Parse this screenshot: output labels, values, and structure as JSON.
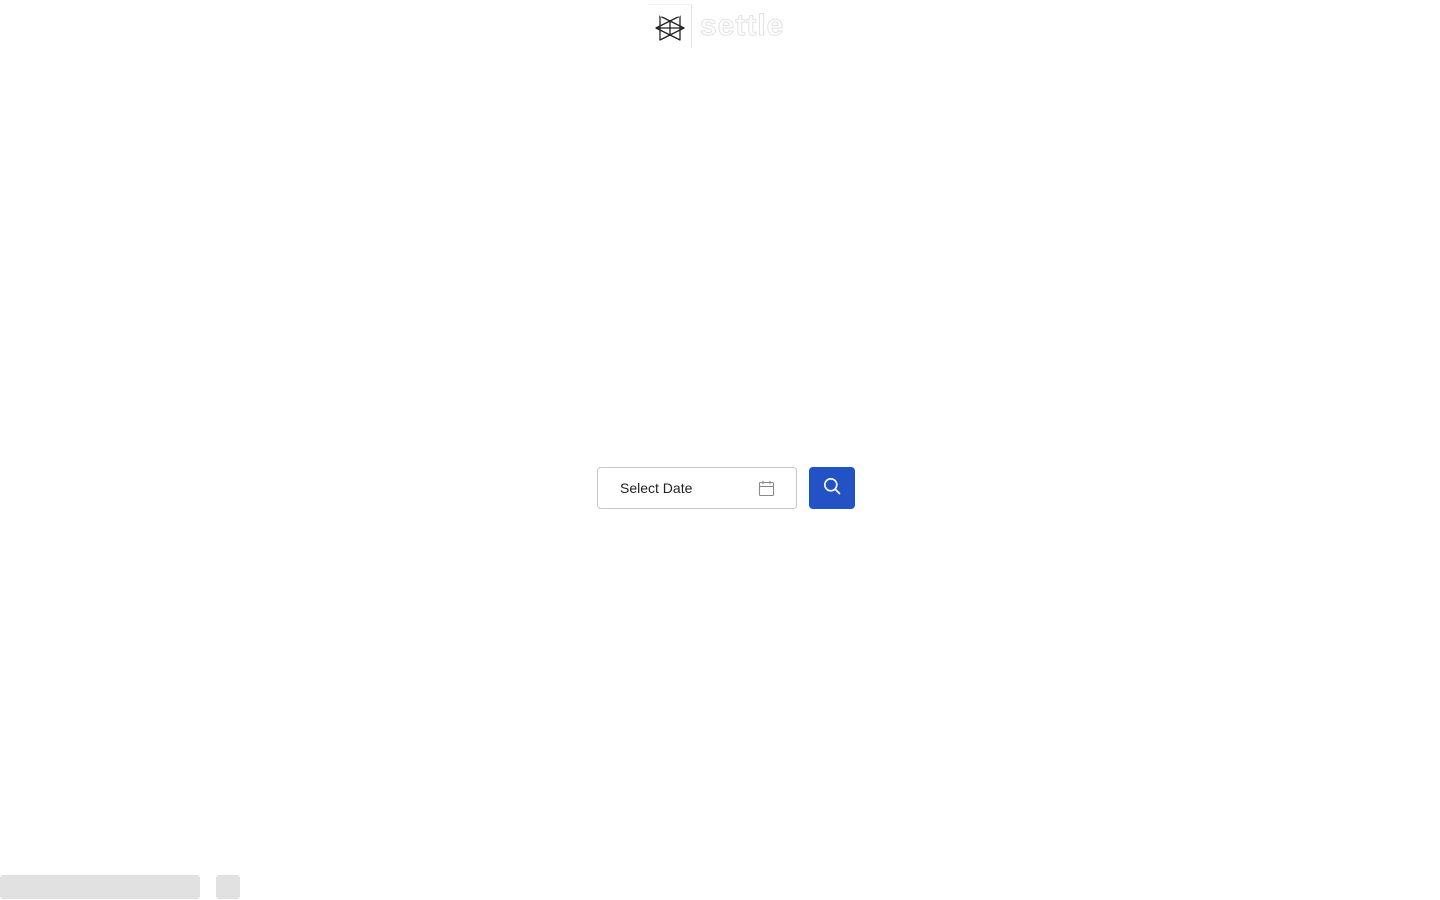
{
  "header": {
    "logo_icon": "geometric-logo-mark",
    "logo_text": "settle"
  },
  "search": {
    "date_field": {
      "value": "Select Date",
      "icon": "calendar-icon"
    },
    "button": {
      "icon": "search-icon",
      "color": "#2352c4"
    }
  },
  "colors": {
    "accent": "#2352c4",
    "skeleton": "#e1e1e1",
    "border": "#c8c8c8"
  }
}
